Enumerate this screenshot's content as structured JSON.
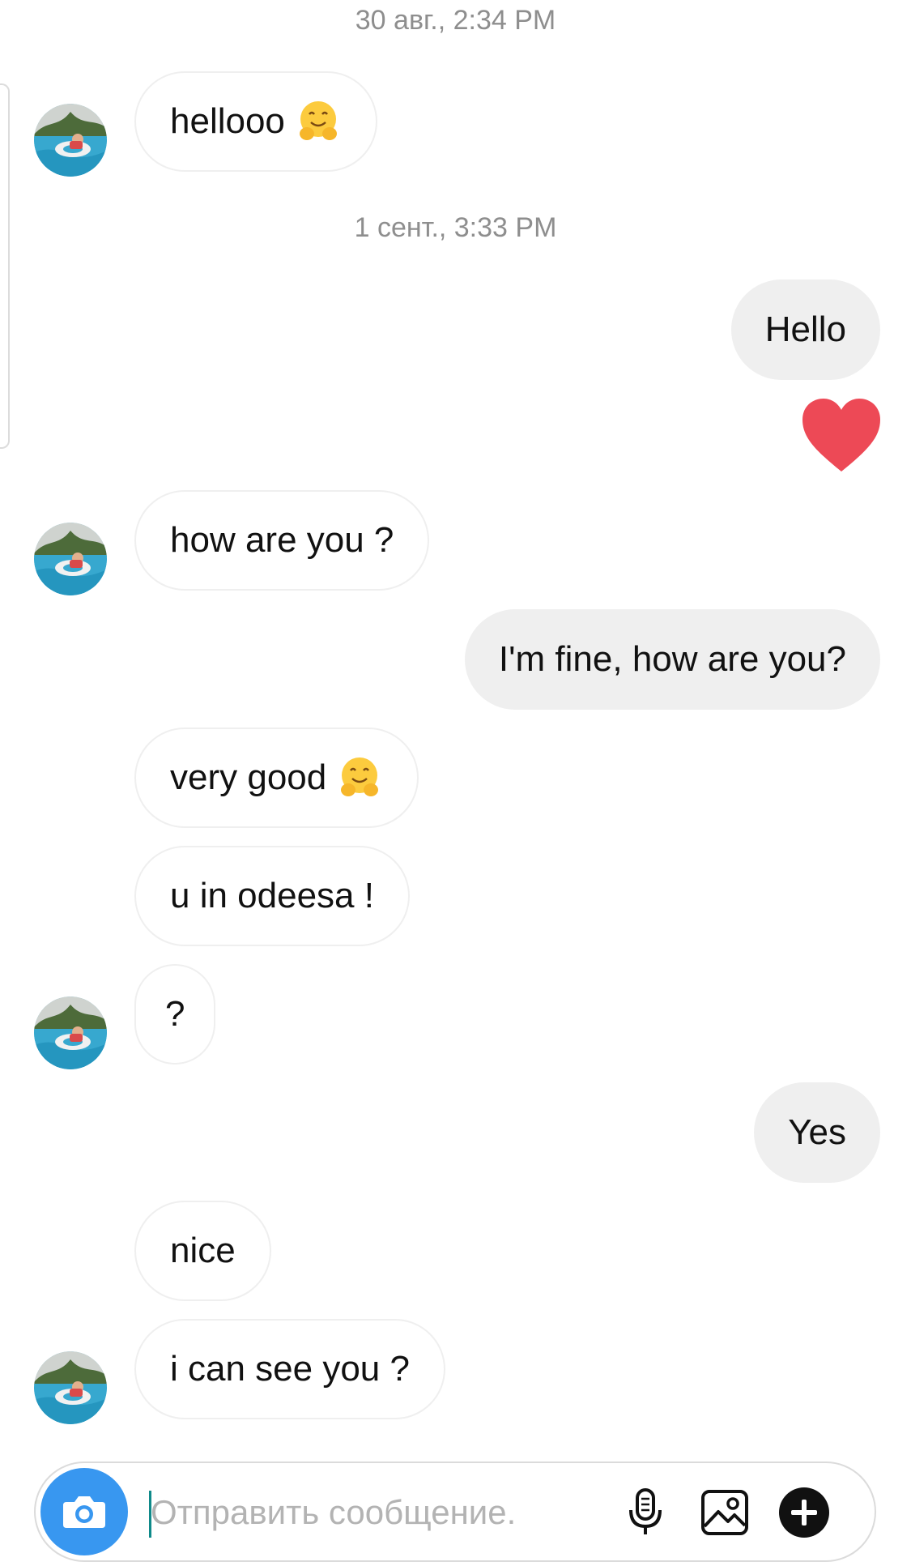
{
  "thread": {
    "timestamps": [
      "30 авг., 2:34 PM",
      "1 сент., 3:33 PM"
    ],
    "messages": [
      {
        "side": "in",
        "text": "hellooo",
        "emoji": "hugging-face"
      },
      {
        "side": "out",
        "text": "Hello"
      },
      {
        "side": "out",
        "reaction": "heart"
      },
      {
        "side": "in",
        "text": "how are you ?"
      },
      {
        "side": "out",
        "text": "I'm fine, how are you?"
      },
      {
        "side": "in",
        "text": "very good",
        "emoji": "hugging-face"
      },
      {
        "side": "in",
        "text": "u in odeesa !"
      },
      {
        "side": "in",
        "text": "?"
      },
      {
        "side": "out",
        "text": "Yes"
      },
      {
        "side": "in",
        "text": "nice"
      },
      {
        "side": "in",
        "text": "i can see you ?"
      }
    ]
  },
  "composer": {
    "placeholder": "Отправить сообщение...",
    "camera_icon": "camera-icon",
    "mic_icon": "microphone-icon",
    "gallery_icon": "image-icon",
    "more_icon": "plus-circle-icon"
  },
  "colors": {
    "accent": "#3897f0",
    "incoming_bubble": "#ffffff",
    "outgoing_bubble": "#efefef",
    "heart": "#ed4956",
    "timestamp": "#8e8e8e"
  }
}
